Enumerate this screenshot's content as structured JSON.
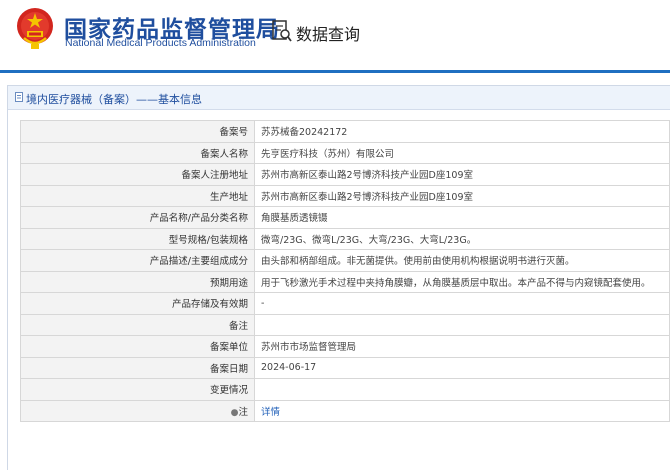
{
  "header": {
    "agency_cn": "国家药品监督管理局",
    "agency_en": "National Medical Products Administration",
    "query_title": "数据查询",
    "accent_color": "#1f6fc1",
    "brand_color": "#1f4e9e"
  },
  "panel": {
    "title": "境内医疗器械（备案）——基本信息"
  },
  "record": [
    {
      "label": "备案号",
      "value": "苏苏械备20242172"
    },
    {
      "label": "备案人名称",
      "value": "先亨医疗科技（苏州）有限公司"
    },
    {
      "label": "备案人注册地址",
      "value": "苏州市高新区泰山路2号博济科技产业园D座109室"
    },
    {
      "label": "生产地址",
      "value": "苏州市高新区泰山路2号博济科技产业园D座109室"
    },
    {
      "label": "产品名称/产品分类名称",
      "value": "角膜基质透镜镊"
    },
    {
      "label": "型号规格/包装规格",
      "value": "微弯/23G、微弯L/23G、大弯/23G、大弯L/23G。"
    },
    {
      "label": "产品描述/主要组成成分",
      "value": "由头部和柄部组成。非无菌提供。使用前由使用机构根据说明书进行灭菌。"
    },
    {
      "label": "预期用途",
      "value": "用于飞秒激光手术过程中夹持角膜瓣，从角膜基质层中取出。本产品不得与内窥镜配套使用。"
    },
    {
      "label": "产品存储及有效期",
      "value": "-"
    },
    {
      "label": "备注",
      "value": ""
    },
    {
      "label": "备案单位",
      "value": "苏州市市场监督管理局"
    },
    {
      "label": "备案日期",
      "value": "2024-06-17"
    },
    {
      "label": "变更情况",
      "value": ""
    }
  ],
  "note": {
    "label": "注",
    "link": "详情"
  }
}
